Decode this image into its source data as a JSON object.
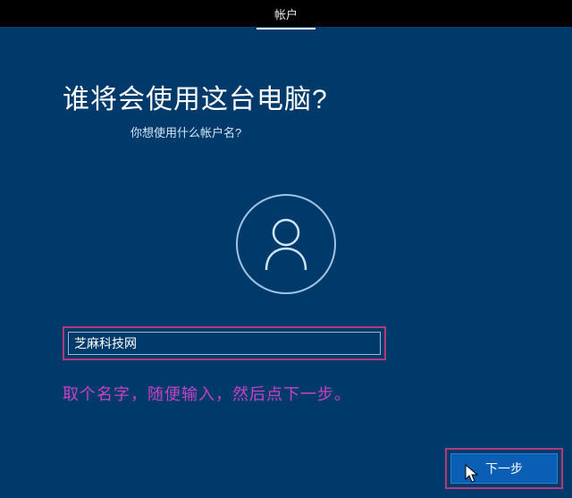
{
  "topbar": {
    "tab_label": "帐户"
  },
  "main": {
    "title": "谁将会使用这台电脑?",
    "subtitle": "你想使用什么帐户名?",
    "username_value": "芝麻科技网"
  },
  "annotation": {
    "text": "取个名字，随便输入，然后点下一步。"
  },
  "footer": {
    "next_label": "下一步"
  }
}
